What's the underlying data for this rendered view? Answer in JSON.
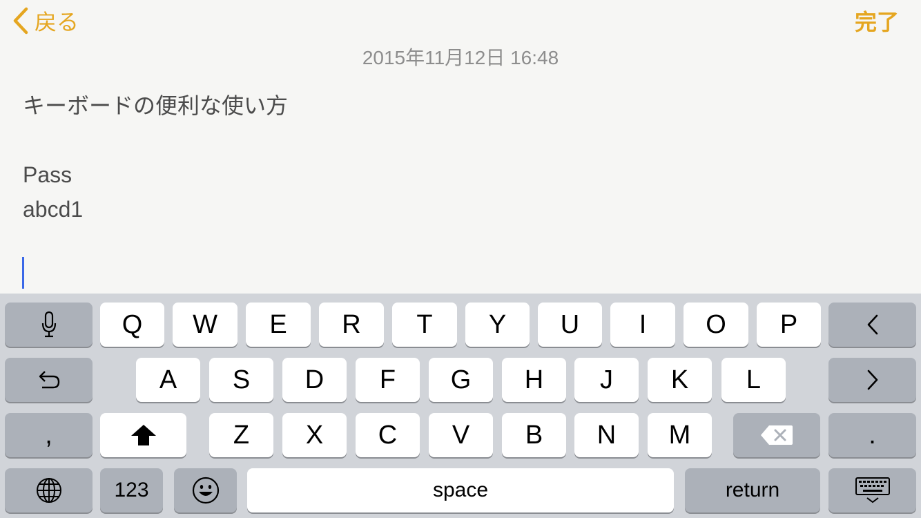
{
  "nav": {
    "back_label": "戻る",
    "done_label": "完了"
  },
  "note": {
    "timestamp": "2015年11月12日 16:48",
    "lines": [
      "キーボードの便利な使い方",
      "",
      "Pass",
      "abcd1"
    ]
  },
  "keyboard": {
    "row1": [
      "Q",
      "W",
      "E",
      "R",
      "T",
      "Y",
      "U",
      "I",
      "O",
      "P"
    ],
    "row2": [
      "A",
      "S",
      "D",
      "F",
      "G",
      "H",
      "J",
      "K",
      "L"
    ],
    "row3": [
      "Z",
      "X",
      "C",
      "V",
      "B",
      "N",
      "M"
    ],
    "comma": ",",
    "period": ".",
    "numbers_label": "123",
    "space_label": "space",
    "return_label": "return"
  },
  "colors": {
    "accent": "#e5a620",
    "caret": "#3a68e8",
    "keyboard_bg": "#d1d4d9"
  }
}
